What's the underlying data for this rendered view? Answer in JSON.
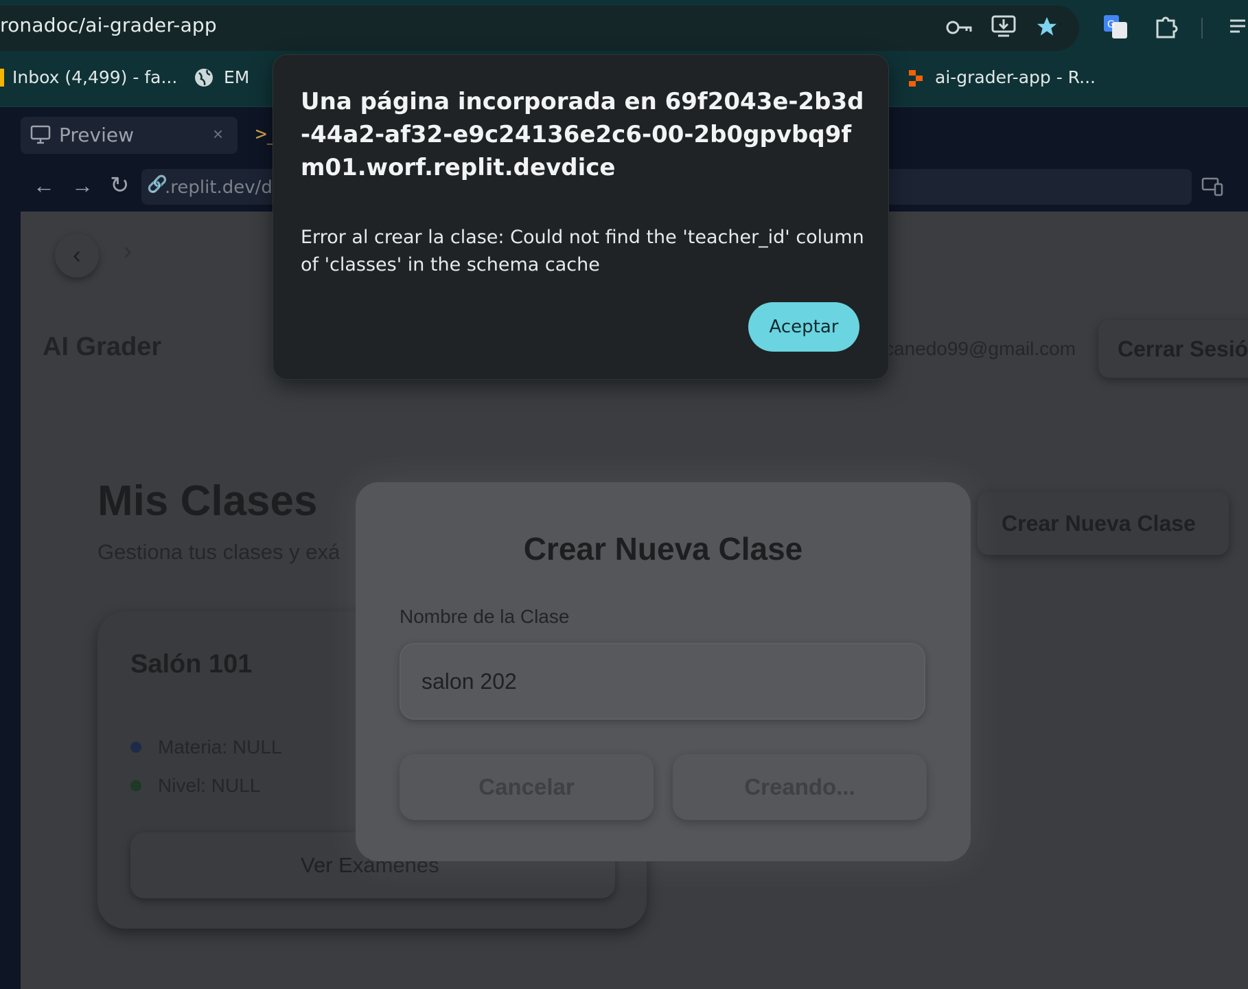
{
  "browser": {
    "url": "ronadoc/ai-grader-app",
    "bookmarks": [
      {
        "label": "Inbox (4,499) - fa..."
      },
      {
        "label": "EM"
      },
      {
        "label": "ai-grader-app - R..."
      }
    ]
  },
  "pane": {
    "tab_label": "Preview",
    "url": ".replit.dev/das"
  },
  "app": {
    "brand": "AI Grader",
    "email": "canedo99@gmail.com",
    "logout_label": "Cerrar Sesió",
    "page_title": "Mis Clases",
    "page_subtitle": "Gestiona tus clases y exá",
    "create_button": "Crear Nueva Clase",
    "card": {
      "title": "Salón 101",
      "materia": "Materia: NULL",
      "nivel": "Nivel: NULL",
      "exams_button": "Ver Exámenes"
    }
  },
  "modal": {
    "title": "Crear Nueva Clase",
    "field_label": "Nombre de la Clase",
    "field_value": "salon 202",
    "cancel_label": "Cancelar",
    "submit_label": "Creando..."
  },
  "alert": {
    "title": "Una página incorporada en 69f2043e-2b3d-44a2-af32-e9c24136e2c6-00-2b0gpvbq9fm01.worf.replit.devdice",
    "message": "Error al crear la clase: Could not find the 'teacher_id' column of 'classes' in the schema cache",
    "ok_label": "Aceptar"
  },
  "colors": {
    "accent": "#6ad4e0",
    "chrome_bg": "#0f3236",
    "dialog_bg": "#1f2325"
  }
}
